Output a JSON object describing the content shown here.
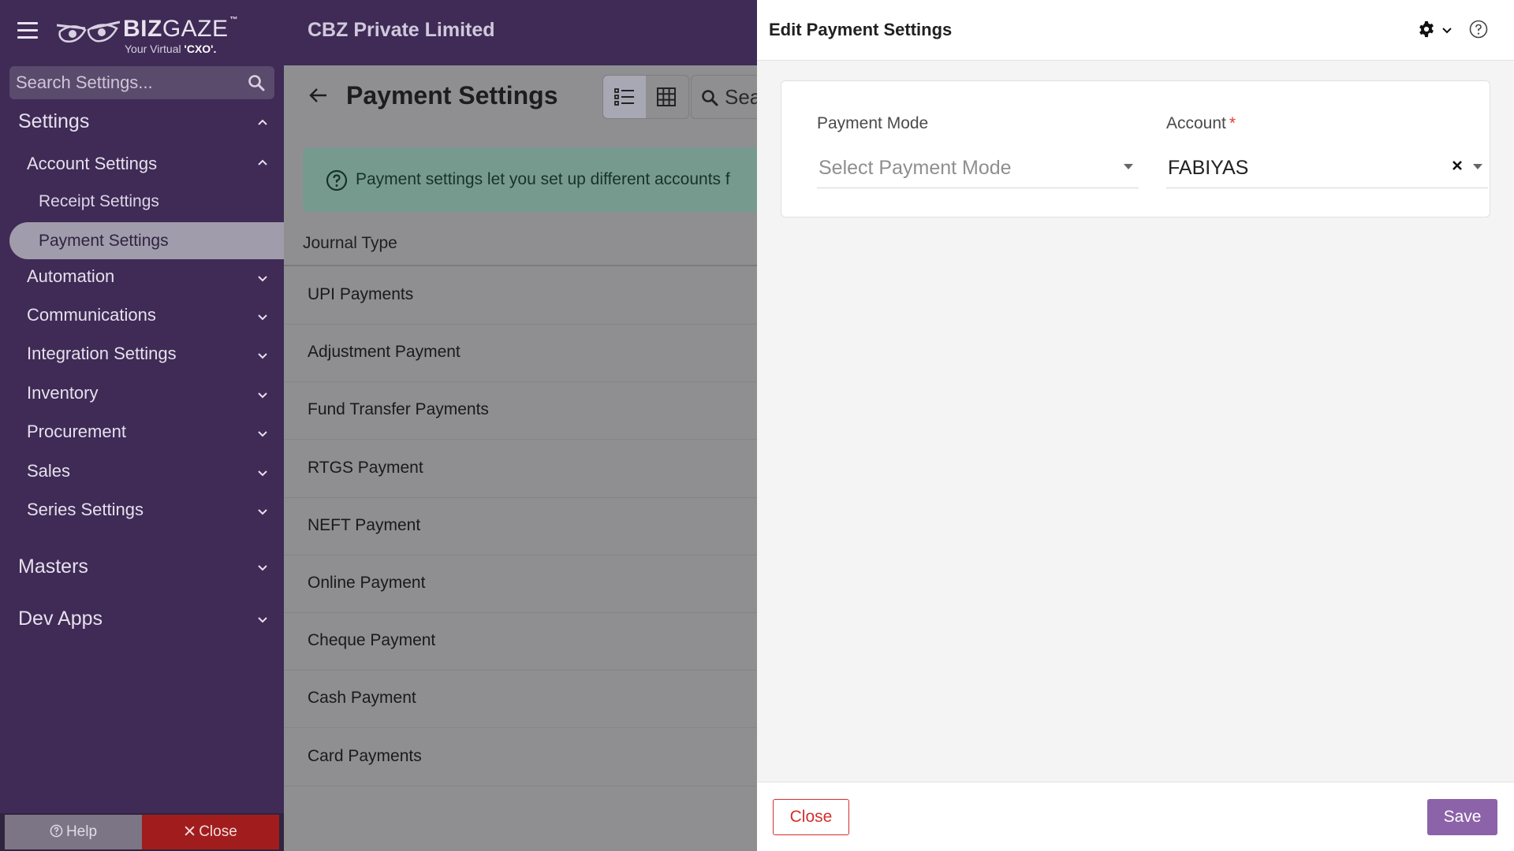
{
  "app": {
    "logo_name": "BIZ",
    "logo_name_light": "GAZE",
    "logo_tm": "™",
    "logo_tagline": "Your Virtual",
    "logo_tagline_bold": "'CXO'.",
    "company": "CBZ Private Limited"
  },
  "sidebar": {
    "search_placeholder": "Search Settings...",
    "settings_label": "Settings",
    "account_settings_label": "Account Settings",
    "receipt_settings_label": "Receipt Settings",
    "payment_settings_label": "Payment Settings",
    "groups": [
      "Automation",
      "Communications",
      "Integration Settings",
      "Inventory",
      "Procurement",
      "Sales",
      "Series Settings"
    ],
    "masters_label": "Masters",
    "dev_apps_label": "Dev Apps",
    "help_label": "Help",
    "close_label": "Close"
  },
  "main": {
    "title": "Payment Settings",
    "search_text": "Sea",
    "banner_text": "Payment settings let you set up different accounts f",
    "column_header": "Journal Type",
    "rows": [
      "UPI Payments",
      "Adjustment Payment",
      "Fund Transfer Payments",
      "RTGS Payment",
      "NEFT Payment",
      "Online Payment",
      "Cheque Payment",
      "Cash Payment",
      "Card Payments"
    ]
  },
  "drawer": {
    "title": "Edit Payment Settings",
    "payment_mode_label": "Payment Mode",
    "payment_mode_placeholder": "Select Payment Mode",
    "account_label": "Account",
    "account_required_mark": "*",
    "account_value": "FABIYAS",
    "close_label": "Close",
    "save_label": "Save"
  },
  "colors": {
    "sidebar_bg": "#3f2b56",
    "accent": "#8c62a8",
    "danger": "#d32f2f",
    "overlay_gray": "#8f8f92"
  }
}
